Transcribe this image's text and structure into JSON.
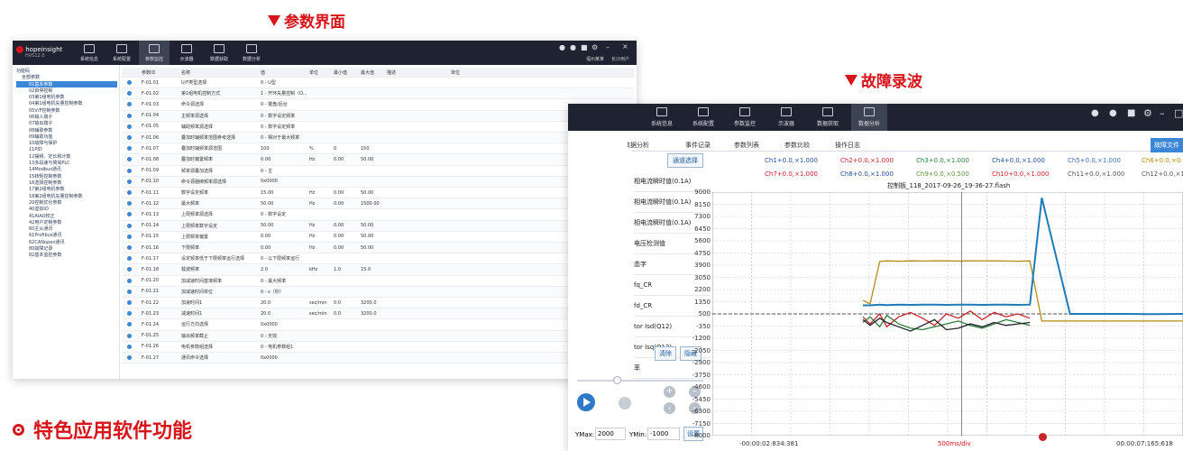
{
  "params_header": "参数界面",
  "wave_header": "故障录波",
  "feature_title": "特色应用软件功能",
  "app": {
    "name": "hopeinsight",
    "version": "HV512.0"
  },
  "toolbar": [
    "系统信息",
    "系统配置",
    "参数监控",
    "示波器",
    "数据获取",
    "数据分析"
  ],
  "user": [
    "福州某某",
    "长沙用户"
  ],
  "tree": [
    "功能码",
    "全部参数",
    "01基本参数",
    "02启停控制",
    "03第1组电机参数",
    "04第1组电机矢量控制参数",
    "05V/F控制参数",
    "06输入端子",
    "07输出端子",
    "08辅助参数",
    "09辅助功能",
    "10故障与保护",
    "11PID",
    "12摆频、定长和计数",
    "13多段速与简易PLC",
    "14Modbus通讯",
    "15转矩控制参数",
    "16选择控制参数",
    "17第2组电机参数",
    "18第2组电机矢量控制参数",
    "20控制优化参数",
    "40虚拟IO",
    "41AIAO校正",
    "42用户定制参数",
    "60主从通讯",
    "61Profibus通讯",
    "62CANopen通讯",
    "80故障记录",
    "82基本监控参数"
  ],
  "grid_header": [
    "参数ID",
    "名称",
    "值",
    "单位",
    "最小值",
    "最大值",
    "描述",
    "单位"
  ],
  "grid_rows": [
    [
      "F-01.01",
      "U/F类型选择",
      "0 - U型",
      "",
      "",
      "",
      ""
    ],
    [
      "F-01.02",
      "第1组电机控制方式",
      "1 - 开环矢量控制（O...",
      "",
      "",
      "",
      ""
    ],
    [
      "F-01.03",
      "命令源选择",
      "0 - 键盘/后台",
      "",
      "",
      "",
      ""
    ],
    [
      "F-01.04",
      "主频率源选择",
      "0 - 数字设定频率",
      "",
      "",
      "",
      ""
    ],
    [
      "F-01.05",
      "辅助频率源选择",
      "0 - 数字设定频率",
      "",
      "",
      "",
      ""
    ],
    [
      "F-01.06",
      "叠加时辅频率范围参考选择",
      "0 - 相对于最大频率",
      "",
      "",
      "",
      ""
    ],
    [
      "F-01.07",
      "叠加时辅频率源范围",
      "100",
      "%",
      "0",
      "150",
      ""
    ],
    [
      "F-01.08",
      "叠加时偏置频率",
      "0.00",
      "Hz",
      "0.00",
      "50.00",
      ""
    ],
    [
      "F-01.09",
      "频率源叠加选择",
      "0 - 主",
      "",
      "",
      "",
      ""
    ],
    [
      "F-01.10",
      "命令源捆绑频率源选择",
      "0x0000",
      "",
      "",
      "",
      ""
    ],
    [
      "F-01.11",
      "数字设定频率",
      "15.00",
      "Hz",
      "0.00",
      "50.00",
      ""
    ],
    [
      "F-01.12",
      "最大频率",
      "50.00",
      "Hz",
      "0.00",
      "1500.00",
      ""
    ],
    [
      "F-01.13",
      "上限频率源选择",
      "0 - 数字设定",
      "",
      "",
      "",
      ""
    ],
    [
      "F-01.14",
      "上限频率数字设定",
      "50.00",
      "Hz",
      "0.00",
      "50.00",
      ""
    ],
    [
      "F-01.15",
      "上限频率偏置",
      "0.00",
      "Hz",
      "0.00",
      "50.00",
      ""
    ],
    [
      "F-01.16",
      "下限频率",
      "0.00",
      "Hz",
      "0.00",
      "50.00",
      ""
    ],
    [
      "F-01.17",
      "设定频率低于下限频率运行选择",
      "0 - 以下限频率运行",
      "",
      "",
      "",
      ""
    ],
    [
      "F-01.18",
      "载波频率",
      "2.0",
      "kHz",
      "1.0",
      "15.0",
      ""
    ],
    [
      "F-01.20",
      "加减速时间基准频率",
      "0 - 最大频率",
      "",
      "",
      "",
      ""
    ],
    [
      "F-01.21",
      "加减速时间单位",
      "0 - s（秒）",
      "",
      "",
      "",
      ""
    ],
    [
      "F-01.22",
      "加速时间1",
      "20.0",
      "sec/min",
      "0.0",
      "3200.0",
      ""
    ],
    [
      "F-01.23",
      "减速时间1",
      "20.0",
      "sec/min",
      "0.0",
      "3200.0",
      ""
    ],
    [
      "F-01.24",
      "运行方向选择",
      "0x0000",
      "",
      "",
      "",
      ""
    ],
    [
      "F-01.25",
      "输出频率截止",
      "0 - 无效",
      "",
      "",
      "",
      ""
    ],
    [
      "F-01.26",
      "电机参数组选择",
      "0 - 电机参数组1",
      "",
      "",
      "",
      ""
    ],
    [
      "F-01.27",
      "通讯命令选择",
      "0x0000",
      "",
      "",
      "",
      ""
    ]
  ],
  "wave": {
    "tabs": [
      "数据分析",
      "事件记录",
      "参数列表",
      "参数比较",
      "操作日志"
    ],
    "select_button": "通道选择",
    "export_button": "故障文件",
    "left_list": [
      "相电流瞬时值(0.1A)",
      "相电流瞬时值(0.1A)",
      "相电流瞬时值(0.1A)",
      "电压检测值",
      "态字",
      "fq_CR",
      "fd_CR",
      "tor Isd(Q12)",
      "tor Isq(Q12)",
      "率"
    ],
    "clear_button": "清除",
    "hide_button": "隐藏",
    "ymax_label": "YMax:",
    "ymax": "2000",
    "ymin_label": "YMin:",
    "ymin": "-1000",
    "set_button": "设置",
    "channels_row1": [
      "Ch1+0.0,×1.000",
      "Ch2+0.0,×1.000",
      "Ch3+0.0,×1.000",
      "Ch4+0.0,×1.000",
      "Ch5+0.0,×1.000",
      "Ch6+0.0,×0.500"
    ],
    "channels_row2": [
      "Ch7+0.0,×1.000",
      "Ch8+0.0,×1.000",
      "Ch9+0.0,×0.500",
      "Ch10+0.0,×1.000",
      "Ch11+0.0,×1.000",
      "Ch12+0.0,×1.000"
    ],
    "channel_colors": [
      "#1f4e9c",
      "#c9252b",
      "#2a7c3c",
      "#1f4e9c",
      "#3d6fb4",
      "#b58a12",
      "#c9252b",
      "#1f4e9c",
      "#5a9b38",
      "#c9252b",
      "#555555",
      "#555555"
    ],
    "file_name": "控制板_118_2017-09-26_19-36-27.flash",
    "time_start": "-00:00:02:834:381",
    "time_div": "500ms/div",
    "time_end": "00:00:07:165:618"
  },
  "chart_data": {
    "type": "line",
    "title": "控制板_118_2017-09-26_19-36-27.flash",
    "xlabel": "500ms/div",
    "ylim": [
      -8000,
      9000
    ],
    "yticks": [
      9000,
      8150,
      7300,
      6450,
      5600,
      4750,
      3900,
      3050,
      2200,
      1350,
      500,
      -350,
      -1200,
      -2050,
      -2900,
      -3750,
      -4600,
      -5450,
      -6300,
      -7150,
      -8000
    ],
    "x": [
      0,
      0.03,
      0.07,
      0.1,
      0.15,
      0.2,
      0.25,
      0.3,
      0.35,
      0.4,
      0.45,
      0.5,
      0.55,
      0.6,
      0.65,
      0.7,
      0.75,
      0.8,
      0.85,
      0.9,
      0.95,
      1.0
    ],
    "grid": true,
    "series": [
      {
        "color": "#b58a12",
        "values": [
          1450,
          1200,
          4150,
          4200,
          4180,
          4200,
          4190,
          4210,
          4200,
          4190,
          4200,
          4210,
          4200,
          4190,
          4180,
          4200,
          0,
          0,
          0,
          0,
          0,
          0
        ]
      },
      {
        "color": "#1f7ab8",
        "values": [
          1100,
          1100,
          1150,
          1120,
          1140,
          1130,
          1150,
          1140,
          1130,
          1150,
          1140,
          1130,
          1150,
          1140,
          1130,
          1150,
          8600,
          500,
          500,
          500,
          480,
          500
        ]
      },
      {
        "color": "#c9252b",
        "values": [
          300,
          -200,
          500,
          -400,
          300,
          600,
          200,
          -300,
          500,
          200,
          700,
          100,
          600,
          300,
          500,
          200,
          0,
          0,
          0,
          0,
          0,
          0
        ]
      },
      {
        "color": "#2a7c3c",
        "values": [
          -100,
          300,
          -400,
          400,
          -200,
          -500,
          -600,
          -400,
          -200,
          0,
          -300,
          -500,
          -200,
          100,
          -100,
          -300,
          0,
          0,
          0,
          0,
          0,
          0
        ]
      },
      {
        "color": "#222222",
        "values": [
          100,
          -300,
          200,
          -100,
          -400,
          -700,
          -300,
          100,
          -600,
          -500,
          -200,
          -400,
          -100,
          -300,
          -200,
          -100,
          0,
          0,
          0,
          0,
          0,
          0
        ]
      }
    ]
  }
}
